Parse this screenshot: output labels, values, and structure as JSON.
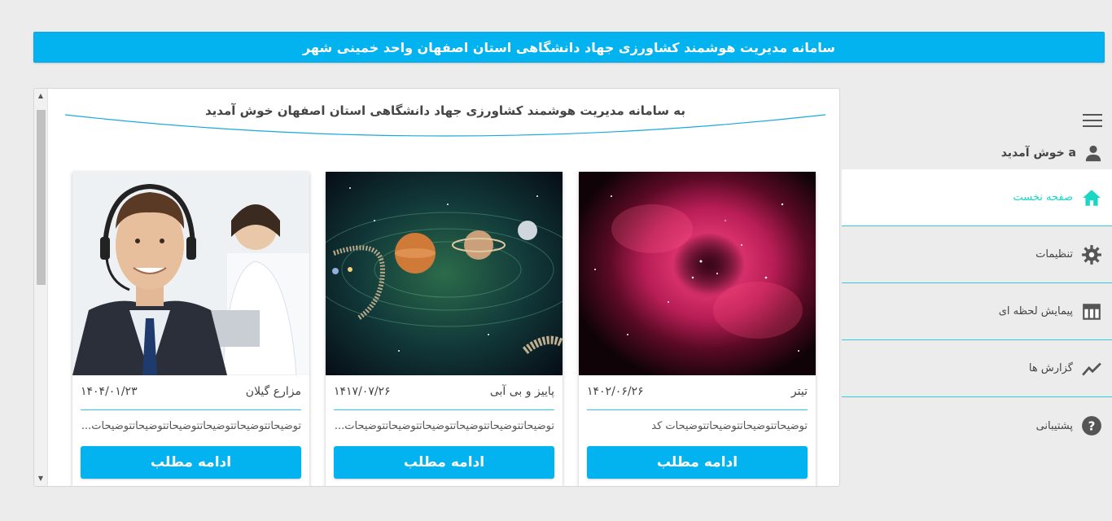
{
  "header": {
    "title": "سامانه مدیریت هوشمند کشاورزی جهاد دانشگاهی استان اصفهان واحد خمینی شهر"
  },
  "main": {
    "welcome": "به سامانه مدیریت هوشمند کشاورزی جهاد دانشگاهی استان اصفهان خوش آمدید",
    "cards": [
      {
        "title": "تیتر",
        "date": "۱۴۰۲/۰۶/۲۶",
        "description": "توضیحاتتوضیحاتتوضیحاتتوضیحات کد",
        "button": "ادامه مطلب",
        "image": "nebula-image"
      },
      {
        "title": "پاییز و بی آبی",
        "date": "۱۴۱۷/۰۷/۲۶",
        "description": "توضیحاتتوضیحاتتوضیحاتتوضیحاتتوضیحاتتوضیحات...",
        "button": "ادامه مطلب",
        "image": "solar-system-image"
      },
      {
        "title": "مزارع گیلان",
        "date": "۱۴۰۴/۰۱/۲۳",
        "description": "توضیحاتتوضیحاتتوضیحاتتوضیحاتتوضیحاتتوضیحات...",
        "button": "ادامه مطلب",
        "image": "support-agent-image"
      }
    ]
  },
  "sidebar": {
    "user_greeting": "a خوش آمدید",
    "items": [
      {
        "label": "صفحه نخست",
        "icon": "home-icon",
        "active": true
      },
      {
        "label": "تنظیمات",
        "icon": "gear-icon"
      },
      {
        "label": "پیمایش لحظه ای",
        "icon": "table-icon"
      },
      {
        "label": "گزارش ها",
        "icon": "chart-line-icon"
      },
      {
        "label": "پشتیبانی",
        "icon": "help-icon"
      }
    ]
  },
  "colors": {
    "accent": "#03b3ef",
    "active": "#1ad6c4",
    "divider": "#31cbe4"
  }
}
